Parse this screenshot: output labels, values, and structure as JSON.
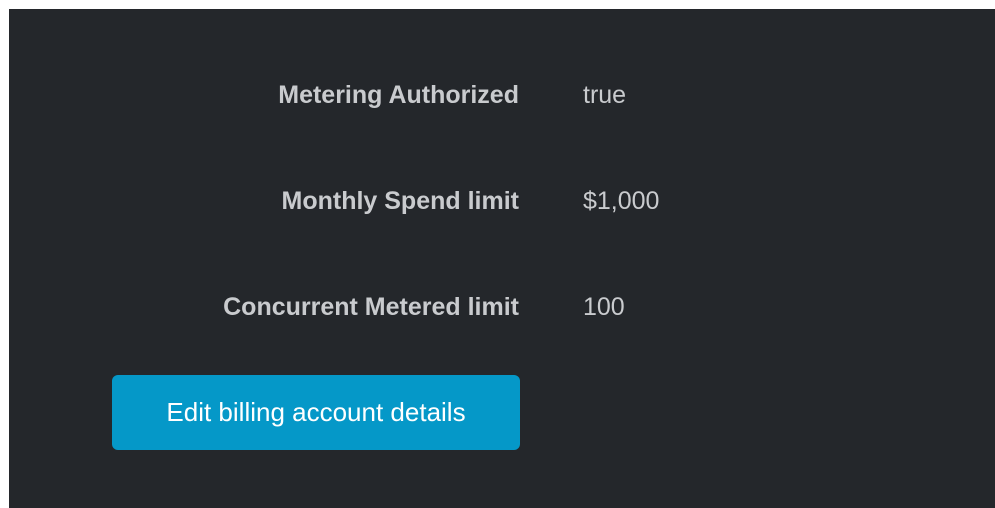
{
  "billing": {
    "rows": [
      {
        "label": "Metering Authorized",
        "value": "true"
      },
      {
        "label": "Monthly Spend limit",
        "value": "$1,000"
      },
      {
        "label": "Concurrent Metered limit",
        "value": "100"
      }
    ],
    "edit_button_label": "Edit billing account details"
  },
  "colors": {
    "panel_background": "#24272b",
    "text": "#c9cbce",
    "button_background": "#0598c8",
    "button_text": "#ffffff"
  }
}
